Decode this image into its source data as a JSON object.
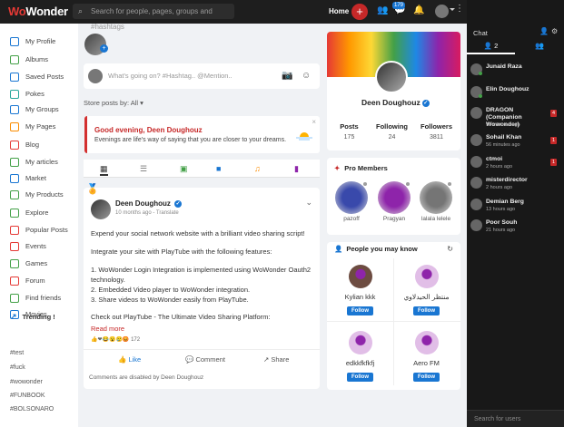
{
  "brand": {
    "logo_pre": "W",
    "logo_o": "o",
    "logo_post": "Wonder"
  },
  "topbar": {
    "search_placeholder": "Search for people, pages, groups and #hashtags",
    "home_label": "Home",
    "plus_label": "+",
    "messages_badge": "179"
  },
  "sidebar": {
    "items": [
      {
        "label": "My Profile",
        "icon": "user-icon",
        "color": "#1976d2"
      },
      {
        "label": "Albums",
        "icon": "image-icon",
        "color": "#43a047"
      },
      {
        "label": "Saved Posts",
        "icon": "bookmark-icon",
        "color": "#1976d2"
      },
      {
        "label": "Pokes",
        "icon": "poke-icon",
        "color": "#26a69a"
      },
      {
        "label": "My Groups",
        "icon": "groups-icon",
        "color": "#1976d2"
      },
      {
        "label": "My Pages",
        "icon": "flag-icon",
        "color": "#fb8c00"
      },
      {
        "label": "Blog",
        "icon": "blog-icon",
        "color": "#e53935"
      },
      {
        "label": "My articles",
        "icon": "book-icon",
        "color": "#43a047"
      },
      {
        "label": "Market",
        "icon": "market-icon",
        "color": "#1976d2"
      },
      {
        "label": "My Products",
        "icon": "cart-icon",
        "color": "#43a047"
      },
      {
        "label": "Explore",
        "icon": "explore-icon",
        "color": "#43a047"
      },
      {
        "label": "Popular Posts",
        "icon": "popular-icon",
        "color": "#e53935"
      },
      {
        "label": "Events",
        "icon": "calendar-icon",
        "color": "#e53935"
      },
      {
        "label": "Games",
        "icon": "games-icon",
        "color": "#43a047"
      },
      {
        "label": "Forum",
        "icon": "forum-icon",
        "color": "#e53935"
      },
      {
        "label": "Find friends",
        "icon": "location-icon",
        "color": "#43a047"
      },
      {
        "label": "Movies",
        "icon": "film-icon",
        "color": "#1976d2"
      }
    ],
    "trending_label": "Trending !",
    "tags": [
      "#test",
      "#fuck",
      "#wowonder",
      "#FUNBOOK",
      "#BOLSONARO"
    ]
  },
  "composer": {
    "placeholder": "What's going on? #Hashtag.. @Mention..",
    "store_by": "Store posts by: All"
  },
  "greeting": {
    "title": "Good evening, Deen Doughouz",
    "subtitle": "Evenings are life's way of saying that you are closer to your dreams.",
    "close": "×"
  },
  "post": {
    "author": "Deen Doughouz",
    "meta": "10 months ago - Translate",
    "lines": [
      "Expend your social network website with a brilliant video sharing script!",
      "Integrate your site with PlayTube with the following features:",
      "1. WoWonder Login Integration is implemented using WoWonder Oauth2",
      "technology.",
      "2. Embedded Video player to WoWonder integration.",
      "3. Share videos to WoWonder easily from PlayTube.",
      "Check out PlayTube - The Ultimate Video Sharing Platform:"
    ],
    "read_more": "Read more",
    "reaction_count": "172",
    "like": "Like",
    "comment": "Comment",
    "share": "Share",
    "comments_disabled": "Comments are disabled by Deen Doughouz"
  },
  "profile": {
    "name": "Deen Doughouz",
    "stats": [
      {
        "label": "Posts",
        "value": "175"
      },
      {
        "label": "Following",
        "value": "24"
      },
      {
        "label": "Followers",
        "value": "3811"
      }
    ]
  },
  "pro_members": {
    "title": "Pro Members",
    "members": [
      {
        "name": "pazoff",
        "color": "#3949ab"
      },
      {
        "name": "Pragyan",
        "color": "#8e24aa"
      },
      {
        "name": "lalala lelele",
        "color": "#757575"
      }
    ]
  },
  "people_you_may_know": {
    "title": "People you may know",
    "follow_label": "Follow",
    "people": [
      {
        "name": "Kylian kkk",
        "color": "#6d4c41"
      },
      {
        "name": "منتظر الحيدلاوي",
        "color": "#e1bee7"
      },
      {
        "name": "edkkfkfkfj",
        "color": "#e1bee7"
      },
      {
        "name": "Aero FM",
        "color": "#e1bee7"
      }
    ]
  },
  "chat": {
    "title": "Chat",
    "online_count": "2",
    "search_placeholder": "Search for users",
    "users": [
      {
        "name": "Junaid Raza",
        "time": "",
        "badge": "",
        "online": true
      },
      {
        "name": "Elin Doughouz",
        "time": "",
        "badge": "",
        "online": true
      },
      {
        "name": "DRAGON (Companion Wowonder)",
        "time": "17 minutes ago",
        "badge": "4",
        "online": false
      },
      {
        "name": "Sohail Khan",
        "time": "56 minutes ago",
        "badge": "1",
        "online": false
      },
      {
        "name": "ctmoi",
        "time": "2 hours ago",
        "badge": "1",
        "online": false
      },
      {
        "name": "misterdirector",
        "time": "2 hours ago",
        "badge": "",
        "online": false
      },
      {
        "name": "Demian Berg",
        "time": "13 hours ago",
        "badge": "",
        "online": false
      },
      {
        "name": "Poor Souh",
        "time": "21 hours ago",
        "badge": "",
        "online": false
      }
    ]
  }
}
